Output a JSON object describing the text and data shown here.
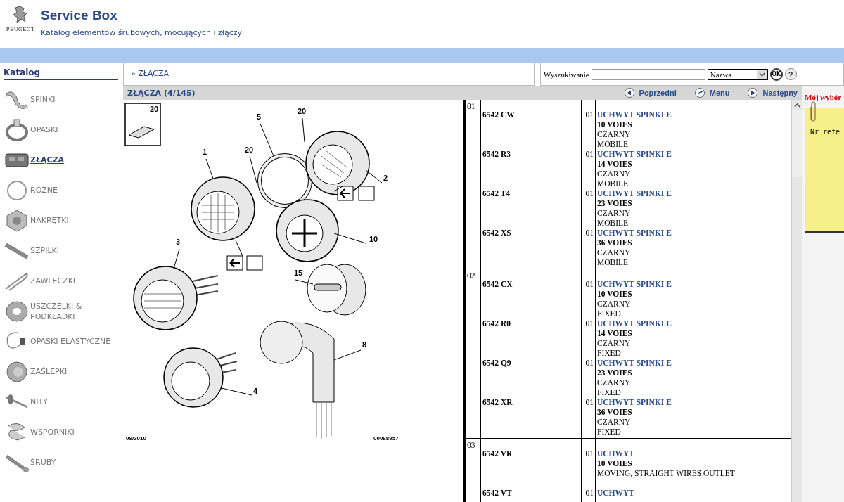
{
  "header": {
    "brand": "PEUGEOT",
    "title": "Service Box",
    "subtitle": "Katalog elementów śrubowych, mocujących i złączy"
  },
  "sidebar": {
    "title": "Katalog",
    "items": [
      {
        "label": "SPINKI",
        "selected": false
      },
      {
        "label": "OPASKI",
        "selected": false
      },
      {
        "label": "ZŁĄCZA",
        "selected": true
      },
      {
        "label": "RÓŻNE",
        "selected": false
      },
      {
        "label": "NAKRĘTKI",
        "selected": false
      },
      {
        "label": "SZPILKI",
        "selected": false
      },
      {
        "label": "ZAWLECZKI",
        "selected": false
      },
      {
        "label": "USZCZELKI & PODKŁADKI",
        "selected": false
      },
      {
        "label": "OPASKI ELASTYCZNE",
        "selected": false
      },
      {
        "label": "ZAŚLEPKI",
        "selected": false
      },
      {
        "label": "NITY",
        "selected": false
      },
      {
        "label": "WSPORNIKI",
        "selected": false
      },
      {
        "label": "ŚRUBY",
        "selected": false
      }
    ]
  },
  "breadcrumb": "» ZŁĄCZA",
  "search": {
    "label": "Wyszukiwanie",
    "mode": "Nazwa",
    "ok": "OK",
    "help": "?"
  },
  "section": {
    "title": "ZŁĄCZA (4/145)",
    "nav": [
      {
        "label": "Poprzedni",
        "kind": "prev"
      },
      {
        "label": "Menu",
        "kind": "menu"
      },
      {
        "label": "Następny",
        "kind": "next"
      }
    ]
  },
  "illustration": {
    "callouts": [
      "20",
      "1",
      "5",
      "20",
      "20",
      "2",
      "10",
      "3",
      "15",
      "8",
      "4"
    ],
    "date": "09/2010",
    "code": "00088957"
  },
  "parts": [
    {
      "ref": "01",
      "items": [
        {
          "part": "6542 CW",
          "qty": "01",
          "name": "UCHWYT SPINKI E",
          "voies": "10 VOIES",
          "details": [
            "CZARNY",
            "MOBILE"
          ]
        },
        {
          "part": "6542 R3",
          "qty": "01",
          "name": "UCHWYT SPINKI E",
          "voies": "14 VOIES",
          "details": [
            "CZARNY",
            "MOBILE"
          ]
        },
        {
          "part": "6542 T4",
          "qty": "01",
          "name": "UCHWYT SPINKI E",
          "voies": "23 VOIES",
          "details": [
            "CZARNY",
            "MOBILE"
          ]
        },
        {
          "part": "6542 XS",
          "qty": "01",
          "name": "UCHWYT SPINKI E",
          "voies": "36 VOIES",
          "details": [
            "CZARNY",
            "MOBILE"
          ]
        }
      ]
    },
    {
      "ref": "02",
      "items": [
        {
          "part": "6542 CX",
          "qty": "01",
          "name": "UCHWYT SPINKI E",
          "voies": "10 VOIES",
          "details": [
            "CZARNY",
            "FIXED"
          ]
        },
        {
          "part": "6542 R0",
          "qty": "01",
          "name": "UCHWYT SPINKI E",
          "voies": "14 VOIES",
          "details": [
            "CZARNY",
            "FIXED"
          ]
        },
        {
          "part": "6542 Q9",
          "qty": "01",
          "name": "UCHWYT SPINKI E",
          "voies": "23 VOIES",
          "details": [
            "CZARNY",
            "FIXED"
          ]
        },
        {
          "part": "6542 XR",
          "qty": "01",
          "name": "UCHWYT SPINKI E",
          "voies": "36 VOIES",
          "details": [
            "CZARNY",
            "FIXED"
          ]
        }
      ]
    },
    {
      "ref": "03",
      "items": [
        {
          "part": "6542 VR",
          "qty": "01",
          "name": "UCHWYT",
          "voies": "10 VOIES",
          "details": [
            "MOVING, STRAIGHT WIRES OUTLET"
          ]
        },
        {
          "part": "6542 VT",
          "qty": "01",
          "name": "UCHWYT"
        }
      ]
    }
  ],
  "selection": {
    "title": "Mój wybór",
    "note": "Nr refe"
  }
}
